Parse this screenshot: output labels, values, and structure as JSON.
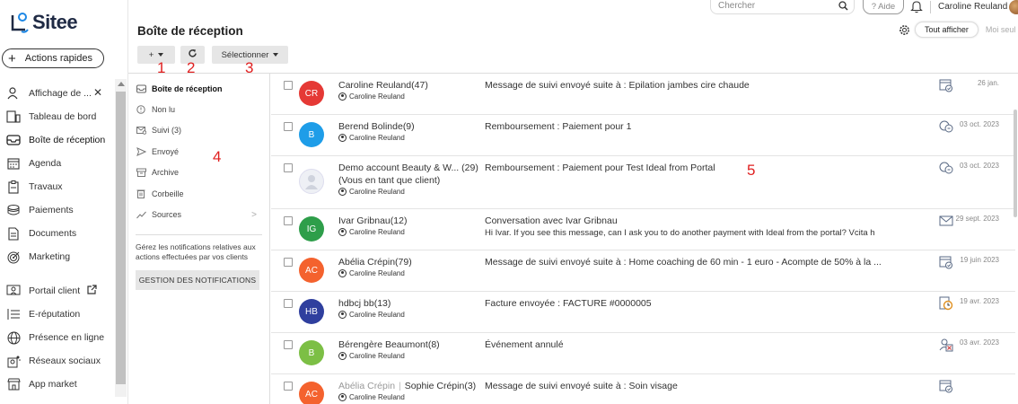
{
  "app": {
    "brand": "Sitee",
    "quick_actions": "Actions rapides"
  },
  "sidebar": {
    "items": [
      {
        "label": "Affichage de ...",
        "icon": "users-icon"
      },
      {
        "label": "Tableau de bord",
        "icon": "dashboard-icon"
      },
      {
        "label": "Boîte de réception",
        "icon": "inbox-icon"
      },
      {
        "label": "Agenda",
        "icon": "calendar-icon"
      },
      {
        "label": "Travaux",
        "icon": "clipboard-icon"
      },
      {
        "label": "Paiements",
        "icon": "coins-icon"
      },
      {
        "label": "Documents",
        "icon": "document-icon"
      },
      {
        "label": "Marketing",
        "icon": "target-icon"
      },
      {
        "label": "Portail client",
        "icon": "portal-icon"
      },
      {
        "label": "E-réputation",
        "icon": "reputation-icon"
      },
      {
        "label": "Présence en ligne",
        "icon": "globe-icon"
      },
      {
        "label": "Réseaux sociaux",
        "icon": "social-icon"
      },
      {
        "label": "App market",
        "icon": "market-icon"
      }
    ]
  },
  "topbar": {
    "search_placeholder": "Chercher",
    "help": "? Aide",
    "user_name": "Caroline Reuland"
  },
  "header": {
    "title": "Boîte de réception",
    "add_label": "+",
    "select_label": "Sélectionner",
    "view_all": "Tout afficher",
    "view_mine": "Moi seul"
  },
  "annotations": [
    "1",
    "2",
    "3",
    "4",
    "5"
  ],
  "folders": {
    "items": [
      {
        "label": "Boîte de réception",
        "icon": "inbox-icon"
      },
      {
        "label": "Non lu",
        "icon": "unread-icon"
      },
      {
        "label": "Suivi (3)",
        "icon": "followup-icon"
      },
      {
        "label": "Envoyé",
        "icon": "send-icon"
      },
      {
        "label": "Archive",
        "icon": "archive-icon"
      },
      {
        "label": "Corbeille",
        "icon": "trash-icon"
      },
      {
        "label": "Sources",
        "icon": "chart-icon"
      }
    ],
    "notif_text": "Gérez les notifications relatives aux actions effectuées par vos clients",
    "notif_button": "GESTION DES NOTIFICATIONS"
  },
  "messages": [
    {
      "initials": "CR",
      "color": "#e53935",
      "name": "Caroline Reuland",
      "count": "(47)",
      "owner": "Caroline Reuland",
      "subject": "Message de suivi envoyé suite à : Epilation jambes cire chaude",
      "preview": "",
      "date": "26 jan.",
      "type_icon": "calendar-check-icon"
    },
    {
      "initials": "B",
      "color": "#1e9de8",
      "name": "Berend Bolinde",
      "count": "(9)",
      "owner": "Caroline Reuland",
      "subject": "Remboursement : Paiement pour 1",
      "preview": "",
      "date": "03 oct. 2023",
      "type_icon": "refund-icon"
    },
    {
      "initials": "",
      "color": "#eef0f5",
      "name": "Demo account Beauty & W...",
      "count": "(29)",
      "name_line2": "(Vous en tant que client)",
      "owner": "Caroline Reuland",
      "subject": "Remboursement : Paiement pour Test Ideal from Portal",
      "preview": "",
      "date": "03 oct. 2023",
      "type_icon": "refund-icon"
    },
    {
      "initials": "IG",
      "color": "#2e9e4a",
      "name": "Ivar Gribnau",
      "count": "(12)",
      "owner": "Caroline Reuland",
      "subject": "Conversation avec Ivar Gribnau",
      "preview": "Hi Ivar. If you see this  message, can I ask you to do another payment with Ideal from the portal? Vcita h",
      "date": "29 sept. 2023",
      "type_icon": "envelope-icon"
    },
    {
      "initials": "AC",
      "color": "#f4622e",
      "name": "Abélia Crépin",
      "count": "(79)",
      "owner": "Caroline Reuland",
      "subject": "Message de suivi envoyé suite à : Home coaching de 60 min - 1 euro - Acompte de 50% à la ...",
      "preview": "",
      "date": "19 juin 2023",
      "type_icon": "calendar-check-icon"
    },
    {
      "initials": "HB",
      "color": "#2f3f9e",
      "name": "hdbcj bb",
      "count": "(13)",
      "owner": "Caroline Reuland",
      "subject": "Facture envoyée : FACTURE #0000005",
      "preview": "",
      "date": "19 avr. 2023",
      "type_icon": "invoice-clock-icon"
    },
    {
      "initials": "B",
      "color": "#7cbf45",
      "name": "Bérengère Beaumont",
      "count": "(8)",
      "owner": "Caroline Reuland",
      "subject": "Événement annulé",
      "preview": "",
      "date": "03 avr. 2023",
      "type_icon": "event-cancel-icon"
    },
    {
      "initials": "AC",
      "color": "#f4622e",
      "name_ghost": "Abélia Crépin",
      "name": "Sophie Crépin",
      "count": "(3)",
      "owner": "Caroline Reuland",
      "subject": "Message de suivi envoyé suite à : Soin visage",
      "preview": "",
      "date": "",
      "type_icon": "calendar-check-icon"
    }
  ]
}
